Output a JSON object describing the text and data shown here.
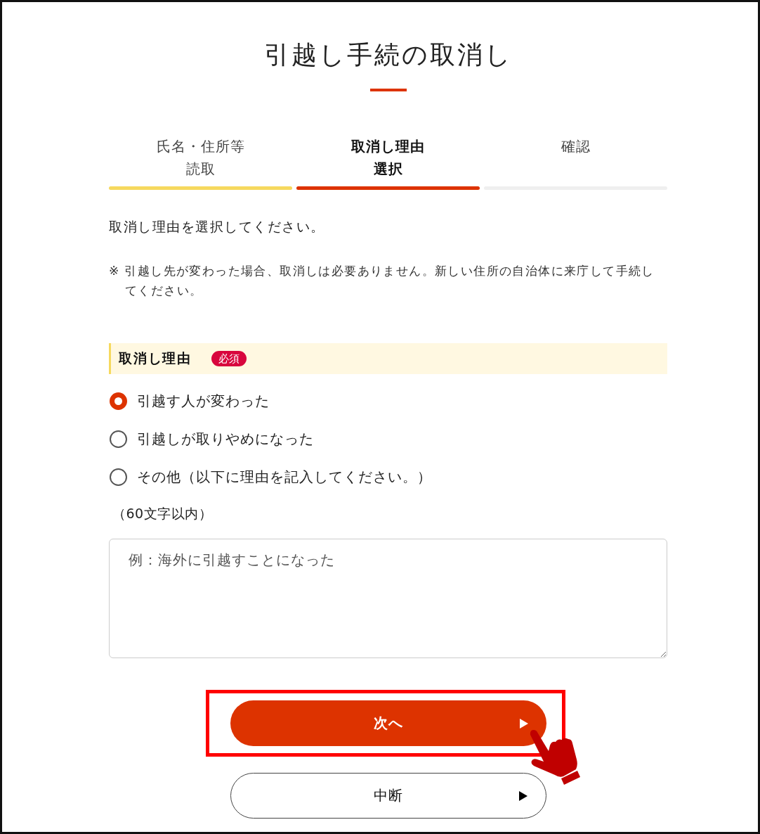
{
  "page": {
    "title": "引越し手続の取消し"
  },
  "steps": [
    {
      "label_lines": [
        "氏名・住所等",
        "読取"
      ],
      "completed": true,
      "selected": false
    },
    {
      "label_lines": [
        "取消し理由",
        "選択"
      ],
      "completed": false,
      "selected": true
    },
    {
      "label_lines": [
        "確認"
      ],
      "completed": false,
      "selected": false
    }
  ],
  "instruction": "取消し理由を選択してください。",
  "note": "※ 引越し先が変わった場合、取消しは必要ありません。新しい住所の自治体に来庁して手続してください。",
  "reason_section": {
    "heading": "取消し理由",
    "badge": "必須",
    "options": [
      {
        "label": "引越す人が変わった",
        "selected": true
      },
      {
        "label": "引越しが取りやめになった",
        "selected": false
      },
      {
        "label": "その他（以下に理由を記入してください。）",
        "selected": false
      }
    ],
    "char_limit": "（60文字以内）",
    "textarea": {
      "placeholder": "例：海外に引越すことになった"
    }
  },
  "buttons": [
    {
      "label": "次へ",
      "kind": "primary",
      "highlighted": true
    },
    {
      "label": "中断",
      "kind": "secondary",
      "highlighted": false
    }
  ]
}
